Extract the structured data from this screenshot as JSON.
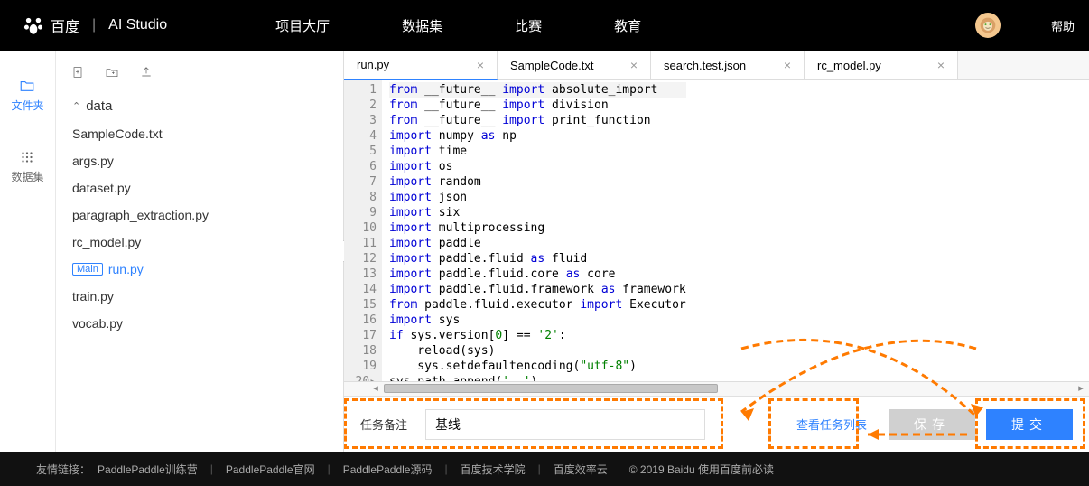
{
  "header": {
    "logo_main": "百度",
    "logo_sub": "AI Studio",
    "nav": [
      "项目大厅",
      "数据集",
      "比赛",
      "教育"
    ],
    "help": "帮助"
  },
  "sidebar": {
    "files_label": "文件夹",
    "dataset_label": "数据集"
  },
  "files": {
    "folder": "data",
    "items": [
      "SampleCode.txt",
      "args.py",
      "dataset.py",
      "paragraph_extraction.py",
      "rc_model.py",
      "run.py",
      "train.py",
      "vocab.py"
    ],
    "main_badge": "Main"
  },
  "tabs": [
    {
      "label": "run.py",
      "active": true
    },
    {
      "label": "SampleCode.txt"
    },
    {
      "label": "search.test.json"
    },
    {
      "label": "rc_model.py"
    }
  ],
  "code": {
    "lines": [
      [
        [
          "kw-blue",
          "from"
        ],
        [
          "",
          " __future__ "
        ],
        [
          "kw-blue",
          "import"
        ],
        [
          "",
          " absolute_import"
        ]
      ],
      [
        [
          "kw-blue",
          "from"
        ],
        [
          "",
          " __future__ "
        ],
        [
          "kw-blue",
          "import"
        ],
        [
          "",
          " division"
        ]
      ],
      [
        [
          "kw-blue",
          "from"
        ],
        [
          "",
          " __future__ "
        ],
        [
          "kw-blue",
          "import"
        ],
        [
          "",
          " print_function"
        ]
      ],
      [
        [
          "",
          ""
        ]
      ],
      [
        [
          "kw-blue",
          "import"
        ],
        [
          "",
          " numpy "
        ],
        [
          "kw-blue",
          "as"
        ],
        [
          "",
          " np"
        ]
      ],
      [
        [
          "kw-blue",
          "import"
        ],
        [
          "",
          " time"
        ]
      ],
      [
        [
          "kw-blue",
          "import"
        ],
        [
          "",
          " os"
        ]
      ],
      [
        [
          "kw-blue",
          "import"
        ],
        [
          "",
          " random"
        ]
      ],
      [
        [
          "kw-blue",
          "import"
        ],
        [
          "",
          " json"
        ]
      ],
      [
        [
          "kw-blue",
          "import"
        ],
        [
          "",
          " six"
        ]
      ],
      [
        [
          "kw-blue",
          "import"
        ],
        [
          "",
          " multiprocessing"
        ]
      ],
      [
        [
          "",
          ""
        ]
      ],
      [
        [
          "kw-blue",
          "import"
        ],
        [
          "",
          " paddle"
        ]
      ],
      [
        [
          "kw-blue",
          "import"
        ],
        [
          "",
          " paddle.fluid "
        ],
        [
          "kw-blue",
          "as"
        ],
        [
          "",
          " fluid"
        ]
      ],
      [
        [
          "kw-blue",
          "import"
        ],
        [
          "",
          " paddle.fluid.core "
        ],
        [
          "kw-blue",
          "as"
        ],
        [
          "",
          " core"
        ]
      ],
      [
        [
          "kw-blue",
          "import"
        ],
        [
          "",
          " paddle.fluid.framework "
        ],
        [
          "kw-blue",
          "as"
        ],
        [
          "",
          " framework"
        ]
      ],
      [
        [
          "kw-blue",
          "from"
        ],
        [
          "",
          " paddle.fluid.executor "
        ],
        [
          "kw-blue",
          "import"
        ],
        [
          "",
          " Executor"
        ]
      ],
      [
        [
          "",
          ""
        ]
      ],
      [
        [
          "kw-blue",
          "import"
        ],
        [
          "",
          " sys"
        ]
      ],
      [
        [
          "kw-blue",
          "if"
        ],
        [
          "",
          " sys.version["
        ],
        [
          "kw-num",
          "0"
        ],
        [
          "",
          "] == "
        ],
        [
          "kw-str",
          "'2'"
        ],
        [
          "",
          ":"
        ]
      ],
      [
        [
          "",
          "    reload(sys)"
        ]
      ],
      [
        [
          "",
          "    sys.setdefaultencoding("
        ],
        [
          "kw-str",
          "\"utf-8\""
        ],
        [
          "",
          ")"
        ]
      ],
      [
        [
          "",
          "sys.path.append("
        ],
        [
          "kw-str",
          "'..'"
        ],
        [
          "",
          ")"
        ]
      ],
      [
        [
          "",
          ""
        ]
      ]
    ]
  },
  "taskbar": {
    "label": "任务备注",
    "value": "基线",
    "view_link": "查看任务列表",
    "save": "保存",
    "submit": "提交"
  },
  "footer": {
    "prefix": "友情链接：",
    "links": [
      "PaddlePaddle训练营",
      "PaddlePaddle官网",
      "PaddlePaddle源码",
      "百度技术学院",
      "百度效率云"
    ],
    "copy": "© 2019 Baidu 使用百度前必读"
  }
}
